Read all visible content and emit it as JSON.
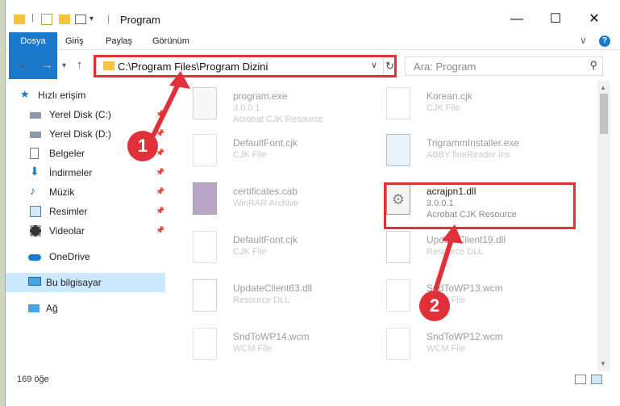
{
  "window": {
    "title": "Program"
  },
  "ribbon": {
    "tabs": [
      "Dosya",
      "Giriş",
      "Paylaş",
      "Görünüm"
    ]
  },
  "address": {
    "path": "C:\\Program Files\\Program Dizini"
  },
  "search": {
    "placeholder": "Ara: Program"
  },
  "sidebar": {
    "items": [
      {
        "label": "Hızlı erişim",
        "icon": "star-icon"
      },
      {
        "label": "Yerel Disk (C:)",
        "icon": "drive-icon"
      },
      {
        "label": "Yerel Disk (D:)",
        "icon": "drive-icon"
      },
      {
        "label": "Belgeler",
        "icon": "documents-icon"
      },
      {
        "label": "İndirmeler",
        "icon": "download-icon"
      },
      {
        "label": "Müzik",
        "icon": "music-icon"
      },
      {
        "label": "Resimler",
        "icon": "pictures-icon"
      },
      {
        "label": "Videolar",
        "icon": "video-icon"
      },
      {
        "label": "OneDrive",
        "icon": "cloud-icon"
      },
      {
        "label": "Bu bilgisayar",
        "icon": "computer-icon"
      },
      {
        "label": "Ağ",
        "icon": "network-icon"
      }
    ]
  },
  "files": [
    {
      "name": "program.exe",
      "meta1": "3.0.0.1",
      "meta2": "Acrobat CJK Resource"
    },
    {
      "name": "Korean.cjk",
      "meta1": "CJK File",
      "meta2": ""
    },
    {
      "name": "DefaultFont.cjk",
      "meta1": "CJK File",
      "meta2": ""
    },
    {
      "name": "TrigrammInstaller.exe",
      "meta1": "ABBY fineReader Ins",
      "meta2": ""
    },
    {
      "name": "certificates.cab",
      "meta1": "WinRAR Archive",
      "meta2": ""
    },
    {
      "name": "acrajpn1.dll",
      "meta1": "3.0.0.1",
      "meta2": "Acrobat CJK Resource"
    },
    {
      "name": "DefaultFont.cjk",
      "meta1": "CJK File",
      "meta2": ""
    },
    {
      "name": "UpdateClient19.dll",
      "meta1": "Resource DLL",
      "meta2": ""
    },
    {
      "name": "UpdateClient63.dll",
      "meta1": "Resource DLL",
      "meta2": ""
    },
    {
      "name": "SndToWP13.wcm",
      "meta1": "WCM File",
      "meta2": ""
    },
    {
      "name": "SndToWP14.wcm",
      "meta1": "WCM File",
      "meta2": ""
    },
    {
      "name": "SndToWP12.wcm",
      "meta1": "WCM File",
      "meta2": ""
    }
  ],
  "status": {
    "count": "169 öğe"
  },
  "annotations": {
    "badge1": "1",
    "badge2": "2"
  },
  "colors": {
    "accent": "#1979ca",
    "highlight": "#e0303a",
    "selected": "#cce8ff"
  }
}
